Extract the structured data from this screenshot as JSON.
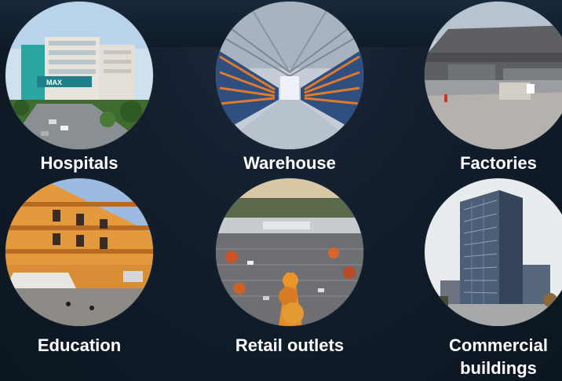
{
  "categories": [
    {
      "label": "Hospitals"
    },
    {
      "label": "Warehouse"
    },
    {
      "label": "Factories"
    },
    {
      "label": "Education"
    },
    {
      "label": "Retail outlets"
    },
    {
      "label": "Commercial\nbuildings"
    }
  ],
  "hospital_sign": "MAX",
  "colors": {
    "background": "#0f1a27",
    "text": "#ffffff"
  }
}
